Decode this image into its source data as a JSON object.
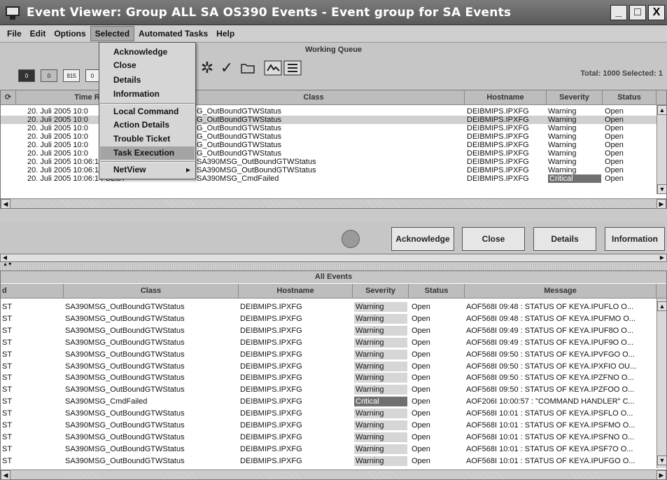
{
  "window": {
    "title": "Event Viewer: Group ALL SA OS390 Events - Event group for SA Events",
    "minimize": "_",
    "maximize": "□",
    "close": "X"
  },
  "menubar": [
    "File",
    "Edit",
    "Options",
    "Selected",
    "Automated Tasks",
    "Help"
  ],
  "selected_menu": {
    "items": [
      "Acknowledge",
      "Close",
      "Details",
      "Information",
      "Local Command",
      "Action Details",
      "Trouble Ticket",
      "Task Execution",
      "NetView"
    ],
    "highlighted": "Task Execution",
    "submenu_arrow": "▸"
  },
  "working_queue": {
    "title": "Working Queue",
    "counters": [
      "0",
      "0",
      "915",
      "0"
    ],
    "total": "Total: 1000 Selected: 1",
    "columns": [
      "Time Re",
      "Class",
      "Hostname",
      "Severity",
      "Status"
    ],
    "rows": [
      {
        "time": "20. Juli 2005 10:0",
        "class": "G_OutBoundGTWStatus",
        "host": "DEIBMIPS.IPXFG",
        "severity": "Warning",
        "status": "Open"
      },
      {
        "time": "20. Juli 2005 10:0",
        "class": "G_OutBoundGTWStatus",
        "host": "DEIBMIPS.IPXFG",
        "severity": "Warning",
        "status": "Open"
      },
      {
        "time": "20. Juli 2005 10:0",
        "class": "G_OutBoundGTWStatus",
        "host": "DEIBMIPS.IPXFG",
        "severity": "Warning",
        "status": "Open"
      },
      {
        "time": "20. Juli 2005 10:0",
        "class": "G_OutBoundGTWStatus",
        "host": "DEIBMIPS.IPXFG",
        "severity": "Warning",
        "status": "Open"
      },
      {
        "time": "20. Juli 2005 10:0",
        "class": "G_OutBoundGTWStatus",
        "host": "DEIBMIPS.IPXFG",
        "severity": "Warning",
        "status": "Open"
      },
      {
        "time": "20. Juli 2005 10:0",
        "class": "G_OutBoundGTWStatus",
        "host": "DEIBMIPS.IPXFG",
        "severity": "Warning",
        "status": "Open"
      },
      {
        "time": "20. Juli 2005 10:06:13 CEST",
        "class": "SA390MSG_OutBoundGTWStatus",
        "host": "DEIBMIPS.IPXFG",
        "severity": "Warning",
        "status": "Open"
      },
      {
        "time": "20. Juli 2005 10:06:14 CEST",
        "class": "SA390MSG_OutBoundGTWStatus",
        "host": "DEIBMIPS.IPXFG",
        "severity": "Warning",
        "status": "Open"
      },
      {
        "time": "20. Juli 2005 10:06:14 CEST",
        "class": "SA390MSG_CmdFailed",
        "host": "DEIBMIPS.IPXFG",
        "severity": "Critical",
        "status": "Open"
      }
    ],
    "buttons": [
      "Acknowledge",
      "Close",
      "Details",
      "Information"
    ]
  },
  "all_events": {
    "title": "All Events",
    "columns": [
      "d",
      "Class",
      "Hostname",
      "Severity",
      "Status",
      "Message"
    ],
    "rows": [
      {
        "d": "ST",
        "class": "SA390MSG_OutBoundGTWStatus",
        "host": "DEIBMIPS.IPXFG",
        "severity": "Warning",
        "status": "Open",
        "message": "AOF568I 09:48 : STATUS OF KEYA.IPUFLO O..."
      },
      {
        "d": "ST",
        "class": "SA390MSG_OutBoundGTWStatus",
        "host": "DEIBMIPS.IPXFG",
        "severity": "Warning",
        "status": "Open",
        "message": "AOF568I 09:48 : STATUS OF KEYA.IPUFMO O..."
      },
      {
        "d": "ST",
        "class": "SA390MSG_OutBoundGTWStatus",
        "host": "DEIBMIPS.IPXFG",
        "severity": "Warning",
        "status": "Open",
        "message": "AOF568I 09:49 : STATUS OF KEYA.IPUF8O O..."
      },
      {
        "d": "ST",
        "class": "SA390MSG_OutBoundGTWStatus",
        "host": "DEIBMIPS.IPXFG",
        "severity": "Warning",
        "status": "Open",
        "message": "AOF568I 09:49 : STATUS OF KEYA.IPUF9O O..."
      },
      {
        "d": "ST",
        "class": "SA390MSG_OutBoundGTWStatus",
        "host": "DEIBMIPS.IPXFG",
        "severity": "Warning",
        "status": "Open",
        "message": "AOF568I 09:50 : STATUS OF KEYA.IPVFGO O..."
      },
      {
        "d": "ST",
        "class": "SA390MSG_OutBoundGTWStatus",
        "host": "DEIBMIPS.IPXFG",
        "severity": "Warning",
        "status": "Open",
        "message": "AOF568I 09:50 : STATUS OF KEYA.IPXFIO OU..."
      },
      {
        "d": "ST",
        "class": "SA390MSG_OutBoundGTWStatus",
        "host": "DEIBMIPS.IPXFG",
        "severity": "Warning",
        "status": "Open",
        "message": "AOF568I 09:50 : STATUS OF KEYA.IPZFNO O..."
      },
      {
        "d": "ST",
        "class": "SA390MSG_OutBoundGTWStatus",
        "host": "DEIBMIPS.IPXFG",
        "severity": "Warning",
        "status": "Open",
        "message": "AOF568I 09:50 : STATUS OF KEYA.IPZFOO O..."
      },
      {
        "d": "ST",
        "class": "SA390MSG_CmdFailed",
        "host": "DEIBMIPS.IPXFG",
        "severity": "Critical",
        "status": "Open",
        "message": "AOF206I 10:00:57 : \"COMMAND HANDLER\" C..."
      },
      {
        "d": "ST",
        "class": "SA390MSG_OutBoundGTWStatus",
        "host": "DEIBMIPS.IPXFG",
        "severity": "Warning",
        "status": "Open",
        "message": "AOF568I 10:01 : STATUS OF KEYA.IPSFLO O..."
      },
      {
        "d": "ST",
        "class": "SA390MSG_OutBoundGTWStatus",
        "host": "DEIBMIPS.IPXFG",
        "severity": "Warning",
        "status": "Open",
        "message": "AOF568I 10:01 : STATUS OF KEYA.IPSFMO O..."
      },
      {
        "d": "ST",
        "class": "SA390MSG_OutBoundGTWStatus",
        "host": "DEIBMIPS.IPXFG",
        "severity": "Warning",
        "status": "Open",
        "message": "AOF568I 10:01 : STATUS OF KEYA.IPSFNO O..."
      },
      {
        "d": "ST",
        "class": "SA390MSG_OutBoundGTWStatus",
        "host": "DEIBMIPS.IPXFG",
        "severity": "Warning",
        "status": "Open",
        "message": "AOF568I 10:01 : STATUS OF KEYA.IPSF7O O..."
      },
      {
        "d": "ST",
        "class": "SA390MSG_OutBoundGTWStatus",
        "host": "DEIBMIPS.IPXFG",
        "severity": "Warning",
        "status": "Open",
        "message": "AOF568I 10:01 : STATUS OF KEYA.IPUFGO O..."
      }
    ]
  },
  "colors": {
    "titlebar": "#666666",
    "critical": "#707070",
    "warning": "#d6d6d6",
    "selected_row": "#d0d0d0"
  }
}
